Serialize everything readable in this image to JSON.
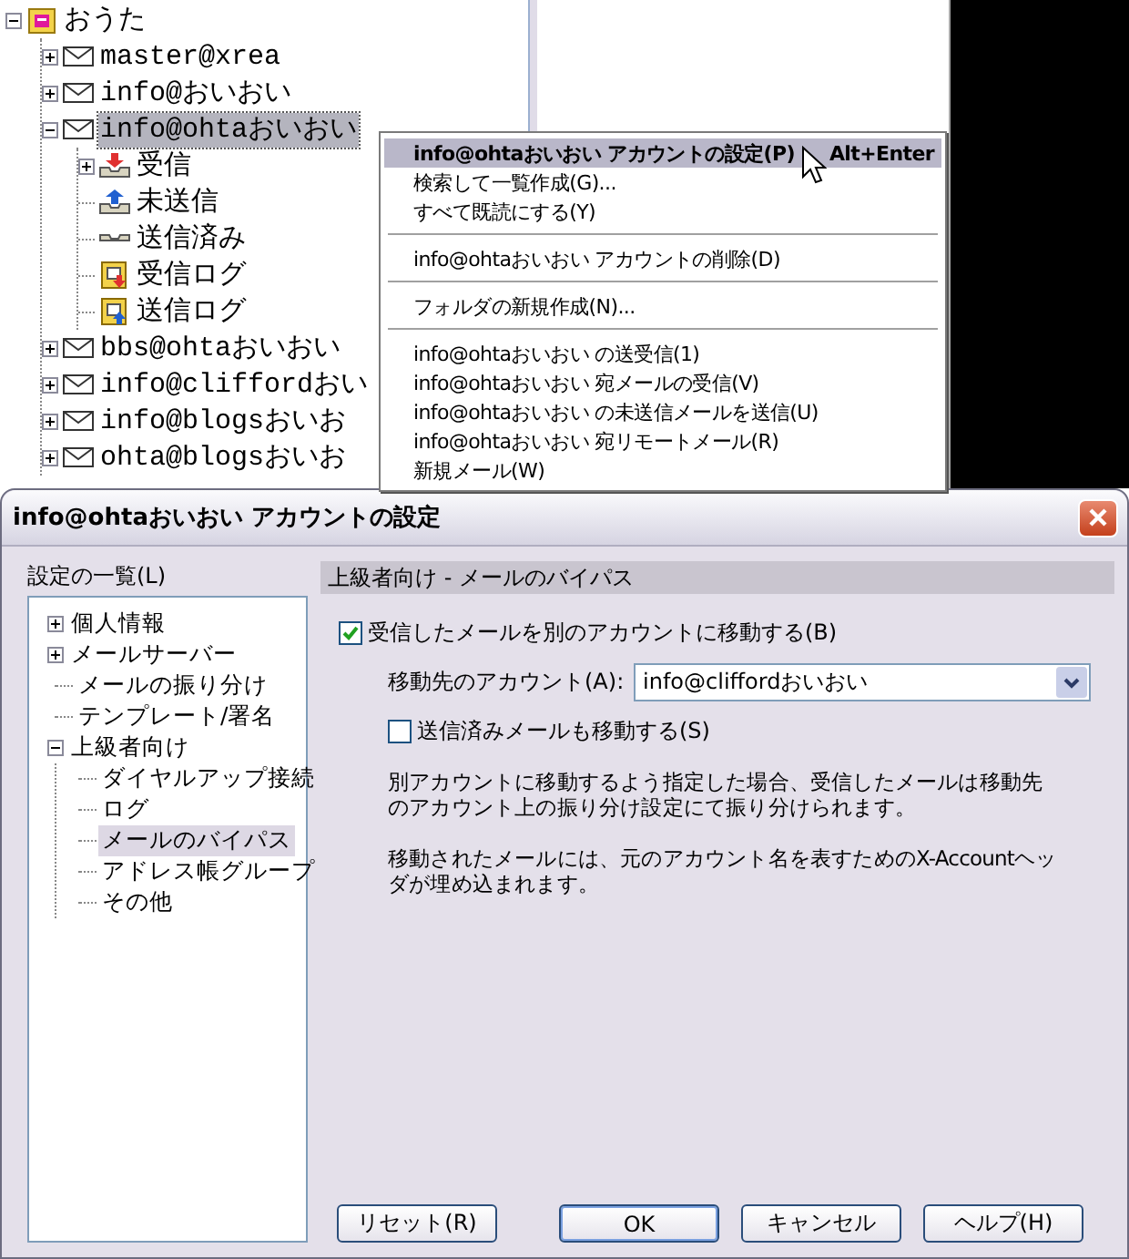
{
  "tree": {
    "items": [
      {
        "label": "おうた",
        "kind": "root",
        "expanded": true,
        "selected": false,
        "children": [
          {
            "label": "master@xrea",
            "kind": "account",
            "expanded": false,
            "selected": false
          },
          {
            "label": "info@おいおい",
            "kind": "account",
            "expanded": false,
            "selected": false
          },
          {
            "label": "info@ohtaおいおい",
            "kind": "account",
            "expanded": true,
            "selected": true,
            "children": [
              {
                "label": "受信",
                "kind": "inbox",
                "expanded": false,
                "selected": false
              },
              {
                "label": "未送信",
                "kind": "outbox",
                "selected": false
              },
              {
                "label": "送信済み",
                "kind": "sent",
                "selected": false
              },
              {
                "label": "受信ログ",
                "kind": "log-in",
                "selected": false
              },
              {
                "label": "送信ログ",
                "kind": "log-out",
                "selected": false
              }
            ]
          },
          {
            "label": "bbs@ohtaおいおい",
            "kind": "account",
            "expanded": false,
            "selected": false
          },
          {
            "label": "info@cliffordおい",
            "kind": "account",
            "expanded": false,
            "selected": false
          },
          {
            "label": "info@blogsおいお",
            "kind": "account",
            "expanded": false,
            "selected": false
          },
          {
            "label": "ohta@blogsおいお",
            "kind": "account",
            "expanded": false,
            "selected": false
          }
        ]
      }
    ]
  },
  "context_menu": {
    "groups": [
      [
        {
          "label": "info@ohtaおいおい アカウントの設定(P)",
          "shortcut": "Alt+Enter",
          "default": true,
          "selected": true
        },
        {
          "label": "検索して一覧作成(G)...",
          "default": false,
          "selected": false
        },
        {
          "label": "すべて既読にする(Y)",
          "default": false,
          "selected": false
        }
      ],
      [
        {
          "label": "info@ohtaおいおい アカウントの削除(D)",
          "default": false,
          "selected": false
        }
      ],
      [
        {
          "label": "フォルダの新規作成(N)...",
          "default": false,
          "selected": false
        }
      ],
      [
        {
          "label": "info@ohtaおいおい の送受信(1)",
          "default": false,
          "selected": false
        },
        {
          "label": "info@ohtaおいおい 宛メールの受信(V)",
          "default": false,
          "selected": false
        },
        {
          "label": "info@ohtaおいおい の未送信メールを送信(U)",
          "default": false,
          "selected": false
        },
        {
          "label": "info@ohtaおいおい 宛リモートメール(R)",
          "default": false,
          "selected": false
        },
        {
          "label": "新規メール(W)",
          "default": false,
          "selected": false
        }
      ]
    ]
  },
  "dialog": {
    "title": "info@ohtaおいおい アカウントの設定",
    "list_label": "設定の一覧(L)",
    "settings_tree": [
      {
        "label": "個人情報",
        "expanded": false,
        "selected": false
      },
      {
        "label": "メールサーバー",
        "expanded": false,
        "selected": false
      },
      {
        "label": "メールの振り分け",
        "selected": false
      },
      {
        "label": "テンプレート/署名",
        "selected": false
      },
      {
        "label": "上級者向け",
        "expanded": true,
        "selected": false,
        "children": [
          {
            "label": "ダイヤルアップ接続",
            "selected": false
          },
          {
            "label": "ログ",
            "selected": false
          },
          {
            "label": "メールのバイパス",
            "selected": true
          },
          {
            "label": "アドレス帳グループ",
            "selected": false
          },
          {
            "label": "その他",
            "selected": false
          }
        ]
      }
    ],
    "section_title": "上級者向け - メールのバイパス",
    "move_checkbox": {
      "label": "受信したメールを別のアカウントに移動する(B)",
      "checked": true
    },
    "account_label": "移動先のアカウント(A):",
    "account_select": {
      "value": "info@cliffordおいおい"
    },
    "sent_checkbox": {
      "label": "送信済みメールも移動する(S)",
      "checked": false
    },
    "notes": [
      "別アカウントに移動するよう指定した場合、受信したメールは移動先のアカウント上の振り分け設定にて振り分けられます。",
      "移動されたメールには、元のアカウント名を表すためのX-Accountヘッダが埋め込まれます。"
    ],
    "reset_button": {
      "label": "リセット(R)"
    },
    "buttons": [
      {
        "label": "OK",
        "default": true
      },
      {
        "label": "キャンセル",
        "default": false
      },
      {
        "label": "ヘルプ(H)",
        "default": false
      }
    ]
  }
}
